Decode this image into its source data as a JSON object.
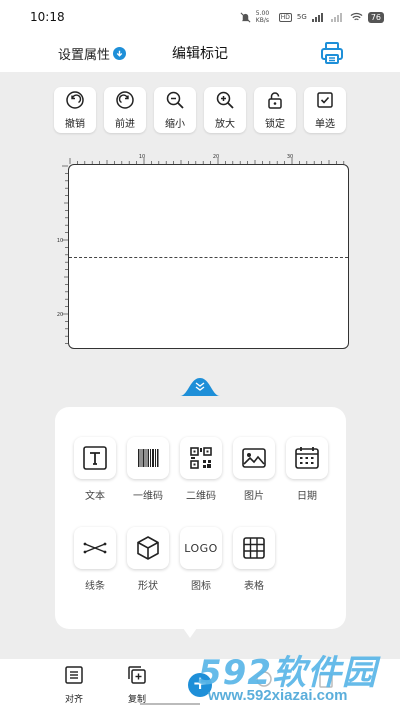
{
  "status_bar": {
    "time": "10:18",
    "net_speed": "5.00 KB/s",
    "network": "5G",
    "battery": "76"
  },
  "header": {
    "settings_label": "设置属性",
    "title": "编辑标记"
  },
  "toolbar": [
    {
      "label": "撤销",
      "icon": "undo-icon"
    },
    {
      "label": "前进",
      "icon": "redo-icon"
    },
    {
      "label": "缩小",
      "icon": "zoom-out-icon"
    },
    {
      "label": "放大",
      "icon": "zoom-in-icon"
    },
    {
      "label": "锁定",
      "icon": "lock-icon"
    },
    {
      "label": "单选",
      "icon": "checkbox-icon"
    }
  ],
  "ruler": {
    "top_labels": [
      "10",
      "20",
      "30"
    ],
    "left_labels": [
      "10",
      "20"
    ]
  },
  "insert_panel": {
    "items": [
      {
        "label": "文本",
        "icon": "text-icon"
      },
      {
        "label": "一维码",
        "icon": "barcode-icon"
      },
      {
        "label": "二维码",
        "icon": "qrcode-icon"
      },
      {
        "label": "图片",
        "icon": "image-icon"
      },
      {
        "label": "日期",
        "icon": "calendar-icon"
      },
      {
        "label": "线条",
        "icon": "line-icon"
      },
      {
        "label": "形状",
        "icon": "cube-icon"
      },
      {
        "label": "图标",
        "icon": "logo-icon",
        "icon_text": "LOGO"
      },
      {
        "label": "表格",
        "icon": "table-icon"
      }
    ]
  },
  "bottom_bar": {
    "align_label": "对齐",
    "copy_label": "复制",
    "fab_symbol": "+"
  },
  "watermark": {
    "big": "592软件园",
    "small": "www.592xiazai.com"
  },
  "colors": {
    "accent": "#1e8fd8",
    "background": "#ededed",
    "panel": "#ffffff"
  }
}
